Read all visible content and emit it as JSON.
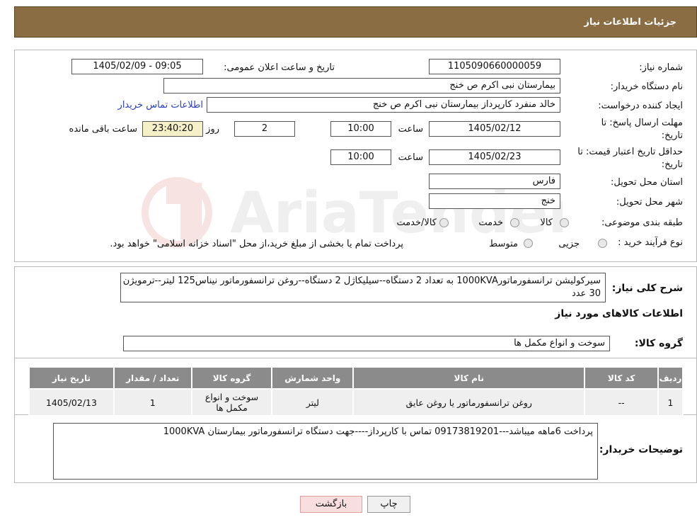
{
  "header": {
    "title": "جزئیات اطلاعات نیاز"
  },
  "form": {
    "need_number_label": "شماره نیاز:",
    "need_number": "1105090660000059",
    "announce_label": "تاریخ و ساعت اعلان عمومی:",
    "announce_value": "1405/02/09 - 09:05",
    "buyer_label": "نام دستگاه خریدار:",
    "buyer": "بیمارستان نبی اکرم  ص  خنج",
    "creator_label": "ایجاد کننده درخواست:",
    "creator": "خالد منفرد کارپرداز بیمارستان نبی اکرم  ص  خنج",
    "contact_link": "اطلاعات تماس خریدار",
    "deadline_label": "مهلت ارسال پاسخ: تا",
    "deadline_label2": "تاریخ:",
    "deadline_date": "1405/02/12",
    "time_label": "ساعت",
    "deadline_time": "10:00",
    "days": "2",
    "days_label": "روز و",
    "remaining": "23:40:20",
    "remaining_label": "ساعت باقی مانده",
    "validity_label": "حداقل تاریخ اعتبار قیمت: تا",
    "validity_label2": "تاریخ:",
    "validity_date": "1405/02/23",
    "validity_time": "10:00",
    "province_label": "استان محل تحویل:",
    "province": "فارس",
    "city_label": "شهر محل تحویل:",
    "city": "خنج",
    "category_label": "طبقه بندی موضوعی:",
    "category_options": [
      "کالا",
      "خدمت",
      "کالا/خدمت"
    ],
    "process_label": "نوع فرآیند خرید :",
    "process_options": [
      "جزیی",
      "متوسط"
    ],
    "process_note": "پرداخت تمام یا بخشی از مبلغ خرید،از محل \"اسناد خزانه اسلامی\" خواهد بود."
  },
  "description": {
    "label": "شرح کلی نیاز:",
    "text": "سیرکولیشن ترانسفورماتور1000KVA به تعداد 2 دستگاه--سیلیکاژل 2 دستگاه--روغن ترانسفورماتور  نیناس125 لیتر--ترمویژن 30 عدد"
  },
  "goods": {
    "section_title": "اطلاعات کالاهای مورد نیاز",
    "group_label": "گروه کالا:",
    "group_value": "سوخت و انواع مکمل ها",
    "columns": [
      "ردیف",
      "کد کالا",
      "نام کالا",
      "واحد شمارش",
      "گروه کالا",
      "تعداد / مقدار",
      "تاریخ نیاز"
    ],
    "rows": [
      [
        "1",
        "--",
        "روغن ترانسفورماتور یا روغن عایق",
        "لیتر",
        "سوخت و انواع مکمل ها",
        "1",
        "1405/02/13"
      ]
    ]
  },
  "buyer_notes": {
    "label": "توضیحات خریدار:",
    "text": "پرداخت 6ماهه میباشد---09173819201 تماس با کارپرداز----جهت دستگاه ترانسفورماتور بیمارستان 1000KVA"
  },
  "buttons": {
    "print": "چاپ",
    "back": "بازگشت"
  },
  "watermark": {
    "text": "AriaTender.neT"
  },
  "colors": {
    "header": "#8b6d44",
    "table_header": "#8b8b8b",
    "remaining_bg": "#f5f0c8",
    "link": "#2a3fbf",
    "back_bg": "#f8dede"
  }
}
